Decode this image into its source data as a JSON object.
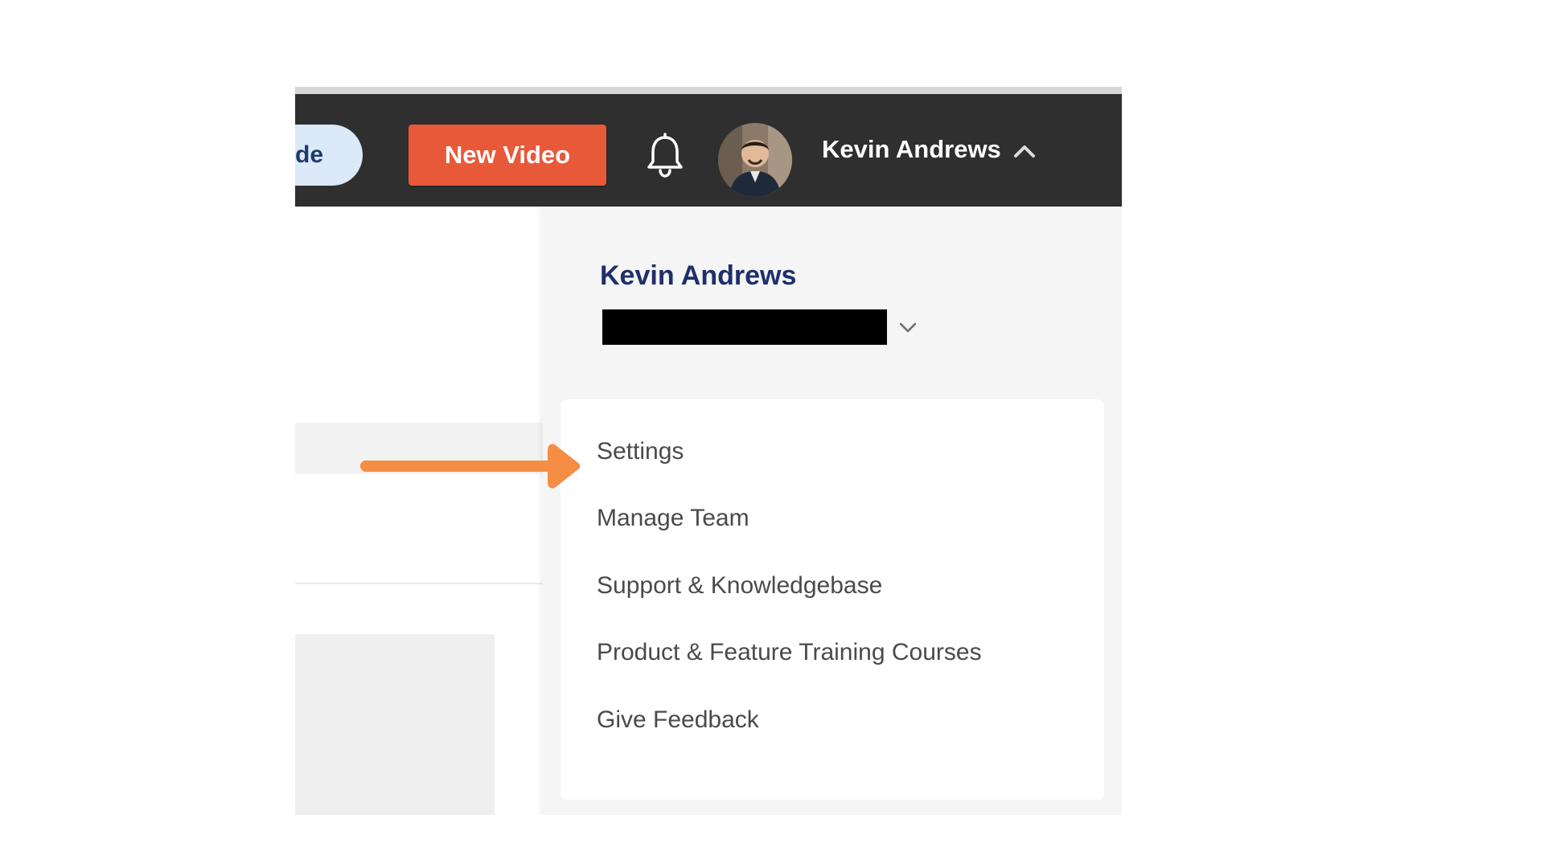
{
  "header": {
    "guide_label_fragment": "de",
    "new_video_label": "New Video",
    "user_name": "Kevin Andrews",
    "bell_icon": "bell-icon",
    "expand_icon": "chevron-up-icon"
  },
  "dropdown": {
    "user_name": "Kevin Andrews",
    "account_selector_icon": "chevron-down-icon",
    "items": [
      {
        "label": "Settings"
      },
      {
        "label": "Manage Team"
      },
      {
        "label": "Support & Knowledgebase"
      },
      {
        "label": "Product & Feature Training Courses"
      },
      {
        "label": "Give Feedback"
      }
    ]
  },
  "colors": {
    "header_bg": "#2f2f2f",
    "new_video_bg": "#e8593a",
    "guide_pill_bg": "#dbe9f8",
    "dropdown_bg": "#f4f5f4",
    "name_color": "#1f2f6b",
    "annotation_arrow": "#f58d45"
  }
}
